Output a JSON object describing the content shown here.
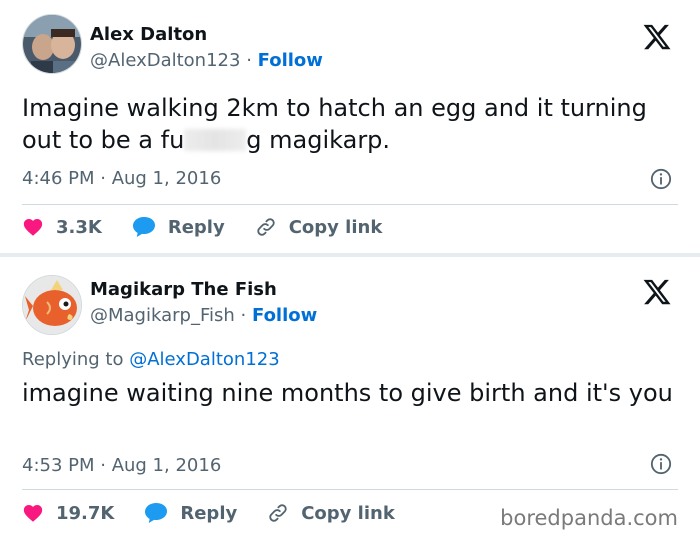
{
  "tweets": [
    {
      "author_name": "Alex Dalton",
      "author_handle": "@AlexDalton123",
      "separator_dot": "·",
      "follow_label": "Follow",
      "text_before": "Imagine walking 2km to hatch an egg and it turning out to be a fu",
      "text_after": "g magikarp.",
      "timestamp": "4:46 PM · Aug 1, 2016",
      "likes": "3.3K",
      "reply_label": "Reply",
      "copy_link_label": "Copy link",
      "icons": [
        "x-logo",
        "info-icon",
        "heart-icon",
        "reply-bubble-icon",
        "link-icon"
      ]
    },
    {
      "author_name": "Magikarp The Fish",
      "author_handle": "@Magikarp_Fish",
      "separator_dot": "·",
      "follow_label": "Follow",
      "replying_to_label": "Replying to",
      "replying_to_handle": "@AlexDalton123",
      "text": "imagine waiting nine months to give birth and it's you",
      "timestamp": "4:53 PM · Aug 1, 2016",
      "likes": "19.7K",
      "reply_label": "Reply",
      "copy_link_label": "Copy link",
      "icons": [
        "x-logo",
        "info-icon",
        "heart-icon",
        "reply-bubble-icon",
        "link-icon"
      ]
    }
  ],
  "watermark": "boredpanda.com",
  "colors": {
    "link_blue": "#006fd6",
    "heart_red": "#f91880",
    "reply_blue": "#1d9bf0",
    "secondary_text": "#536471",
    "separator": "#e6ecf0"
  }
}
